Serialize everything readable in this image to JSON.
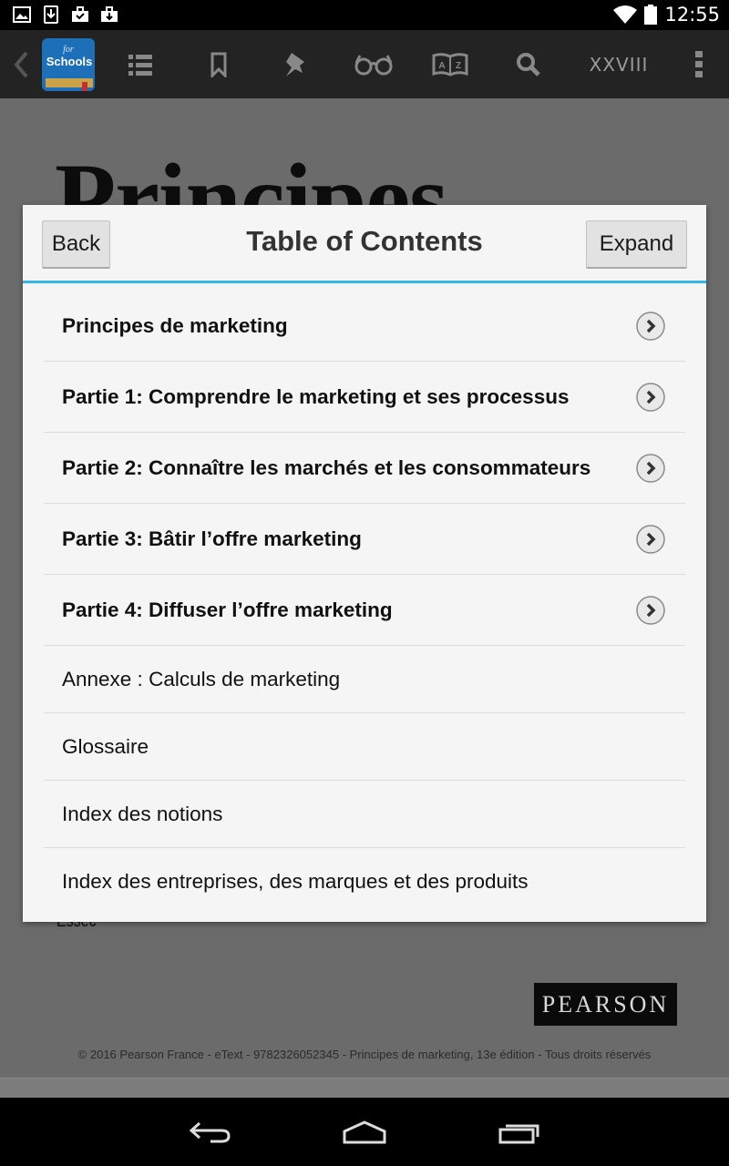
{
  "status_bar": {
    "time": "12:55",
    "icons": [
      "image-icon",
      "download-icon",
      "briefcase-check-icon",
      "briefcase-download-icon",
      "wifi-icon",
      "battery-icon"
    ]
  },
  "toolbar": {
    "back_icon": "chevron-left-icon",
    "app_logo_text": "Schools",
    "app_logo_small": "for",
    "icons": [
      "list-icon",
      "bookmark-icon",
      "pushpin-icon",
      "glasses-icon",
      "dictionary-icon",
      "search-icon",
      "overflow-menu-icon"
    ],
    "page_number": "XXVIII"
  },
  "background_page": {
    "title_fragment": "Principes",
    "author_fragment": "Essec",
    "publisher_logo": "PEARSON",
    "copyright": "© 2016 Pearson France - eText - 9782326052345 - Principes de marketing, 13e édition - Tous droits réservés"
  },
  "dialog": {
    "title": "Table of Contents",
    "back_label": "Back",
    "expand_label": "Expand",
    "accent_color": "#33b5e5",
    "items": [
      {
        "label": "Principes de marketing",
        "bold": true,
        "expandable": true
      },
      {
        "label": "Partie 1: Comprendre le marketing et ses processus",
        "bold": true,
        "expandable": true
      },
      {
        "label": "Partie 2: Connaître les marchés et les consommateurs",
        "bold": true,
        "expandable": true
      },
      {
        "label": "Partie 3: Bâtir l’offre marketing",
        "bold": true,
        "expandable": true
      },
      {
        "label": "Partie 4: Diffuser l’offre marketing",
        "bold": true,
        "expandable": true
      },
      {
        "label": "Annexe : Calculs de marketing",
        "bold": false,
        "expandable": false
      },
      {
        "label": "Glossaire",
        "bold": false,
        "expandable": false
      },
      {
        "label": "Index des notions",
        "bold": false,
        "expandable": false
      },
      {
        "label": "Index des entreprises, des marques et des produits",
        "bold": false,
        "expandable": false
      }
    ]
  },
  "nav_bar": {
    "icons": [
      "back-nav-icon",
      "home-nav-icon",
      "recents-nav-icon"
    ]
  }
}
